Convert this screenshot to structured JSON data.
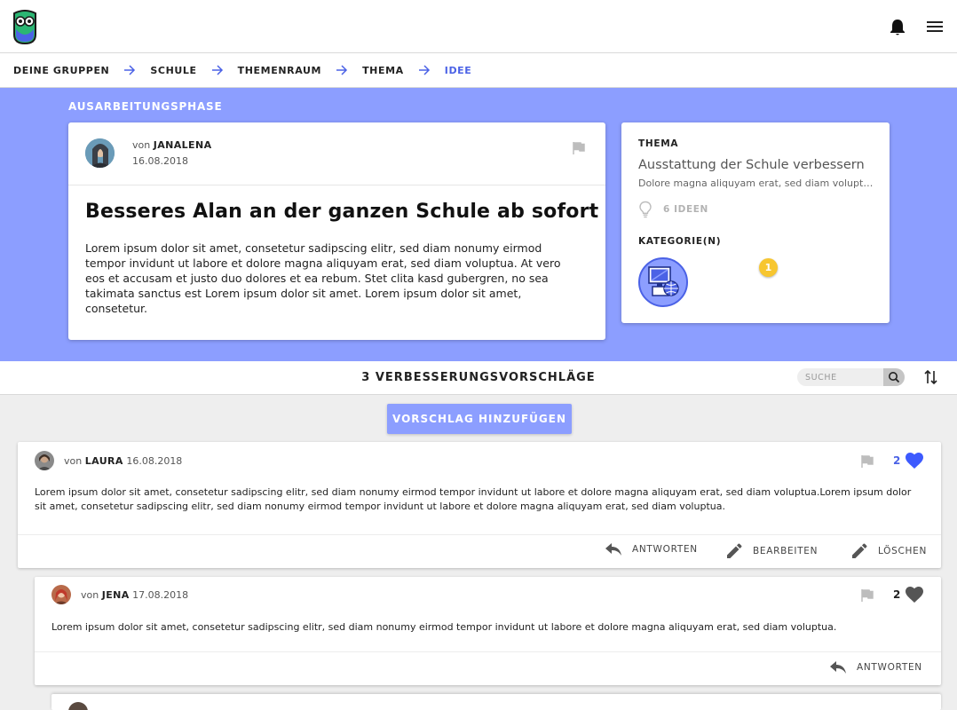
{
  "breadcrumb": [
    "DEINE GRUPPEN",
    "SCHULE",
    "THEMENRAUM",
    "THEMA",
    "IDEE"
  ],
  "phase": "AUSARBEITUNGSPHASE",
  "idea": {
    "von": "von",
    "author": "JANALENA",
    "date": "16.08.2018",
    "title": "Besseres Alan an der ganzen Schule ab sofort",
    "body": "Lorem ipsum dolor sit amet, consetetur sadipscing elitr, sed diam nonumy eirmod tempor invidunt ut labore et dolore magna aliquyam erat, sed diam voluptua. At vero eos et accusam et justo duo dolores et ea rebum. Stet clita kasd gubergren, no sea takimata sanctus est Lorem ipsum dolor sit amet. Lorem ipsum dolor sit amet, consetetur."
  },
  "topic": {
    "heading": "THEMA",
    "title": "Ausstattung der Schule verbessern",
    "subtitle": "Dolore magna aliquyam erat, sed diam voluptua. At vero eos",
    "ideas_count": "6 IDEEN",
    "category_heading": "KATEGORIE(N)",
    "category_badge": "1"
  },
  "suggestions": {
    "count_label": "3 VERBESSERUNGSVORSCHLÄGE",
    "search_placeholder": "SUCHE",
    "add_label": "VORSCHLAG HINZUFÜGEN"
  },
  "comments": [
    {
      "von": "von",
      "author": "LAURA",
      "date": "16.08.2018",
      "text": "Lorem ipsum dolor sit amet, consetetur sadipscing elitr, sed diam nonumy eirmod tempor invidunt ut labore et dolore magna aliquyam erat, sed diam voluptua.Lorem ipsum dolor sit amet, consetetur sadipscing elitr, sed diam nonumy eirmod tempor invidunt ut labore et dolore magna aliquyam erat, sed diam voluptua.",
      "likes": "2",
      "reply": "ANTWORTEN",
      "edit": "BEARBEITEN",
      "delete": "LÖSCHEN"
    },
    {
      "von": "von",
      "author": "JENA",
      "date": "17.08.2018",
      "text": "Lorem ipsum dolor sit amet, consetetur sadipscing elitr, sed diam nonumy eirmod tempor invidunt ut labore et dolore magna aliquyam erat, sed diam voluptua.",
      "likes": "2",
      "reply": "ANTWORTEN"
    }
  ],
  "colors": {
    "accent": "#8c9eff",
    "accent_dark": "#4b62e6",
    "badge": "#f7c630"
  },
  "icons": [
    "logo-icon",
    "bell-icon",
    "menu-icon",
    "arrow-right-icon",
    "flag-icon",
    "lightbulb-icon",
    "search-icon",
    "sort-icon",
    "heart-icon",
    "reply-icon",
    "pencil-icon"
  ]
}
